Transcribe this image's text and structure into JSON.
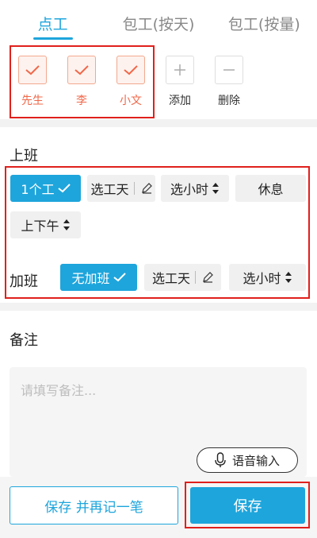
{
  "tabs": [
    {
      "label": "点工",
      "active": true
    },
    {
      "label": "包工(按天)",
      "active": false
    },
    {
      "label": "包工(按量)",
      "active": false
    }
  ],
  "workers": [
    {
      "name": "先生",
      "checked": true
    },
    {
      "name": "李",
      "checked": true
    },
    {
      "name": "小文",
      "checked": true
    }
  ],
  "worker_actions": {
    "add_label": "添加",
    "delete_label": "删除"
  },
  "shift": {
    "title": "上班",
    "one_work": "1个工",
    "select_day": "选工天",
    "select_hours": "选小时",
    "rest": "休息",
    "am_pm": "上下午"
  },
  "overtime": {
    "title": "加班",
    "no_overtime": "无加班",
    "select_day": "选工天",
    "select_hours": "选小时"
  },
  "notes": {
    "title": "备注",
    "placeholder": "请填写备注...",
    "voice_label": "语音输入"
  },
  "footer": {
    "save_and_next": "保存 并再记一笔",
    "save": "保存"
  },
  "colors": {
    "accent": "#1ea5dc",
    "worker_orange": "#f0684a",
    "highlight_red": "#e0201c"
  }
}
